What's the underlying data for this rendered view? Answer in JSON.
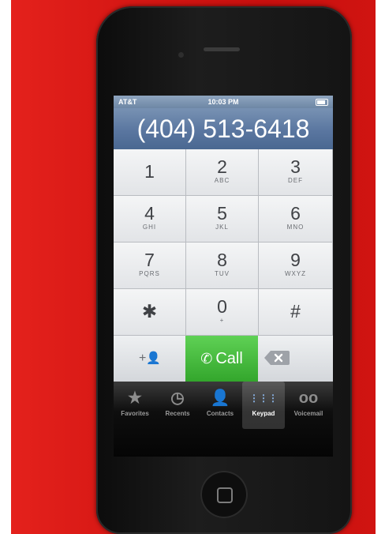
{
  "status_bar": {
    "carrier": "AT&T",
    "time": "10:03 PM"
  },
  "display": {
    "number": "(404) 513-6418"
  },
  "keypad": {
    "keys": [
      {
        "num": "1",
        "letters": ""
      },
      {
        "num": "2",
        "letters": "ABC"
      },
      {
        "num": "3",
        "letters": "DEF"
      },
      {
        "num": "4",
        "letters": "GHI"
      },
      {
        "num": "5",
        "letters": "JKL"
      },
      {
        "num": "6",
        "letters": "MNO"
      },
      {
        "num": "7",
        "letters": "PQRS"
      },
      {
        "num": "8",
        "letters": "TUV"
      },
      {
        "num": "9",
        "letters": "WXYZ"
      },
      {
        "num": "✱",
        "letters": ""
      },
      {
        "num": "0",
        "letters": "+"
      },
      {
        "num": "#",
        "letters": ""
      }
    ],
    "add_contact": "+",
    "call_label": "Call"
  },
  "tabs": [
    {
      "label": "Favorites",
      "icon": "star-icon",
      "glyph": "★"
    },
    {
      "label": "Recents",
      "icon": "clock-icon",
      "glyph": "◷"
    },
    {
      "label": "Contacts",
      "icon": "person-icon",
      "glyph": "👤"
    },
    {
      "label": "Keypad",
      "icon": "keypad-icon",
      "glyph": "⋮⋮⋮"
    },
    {
      "label": "Voicemail",
      "icon": "voicemail-icon",
      "glyph": "oo"
    }
  ],
  "active_tab": "Keypad",
  "colors": {
    "background": "#d01411",
    "call_green": "#3fb637",
    "display_blue": "#5a76a0"
  }
}
